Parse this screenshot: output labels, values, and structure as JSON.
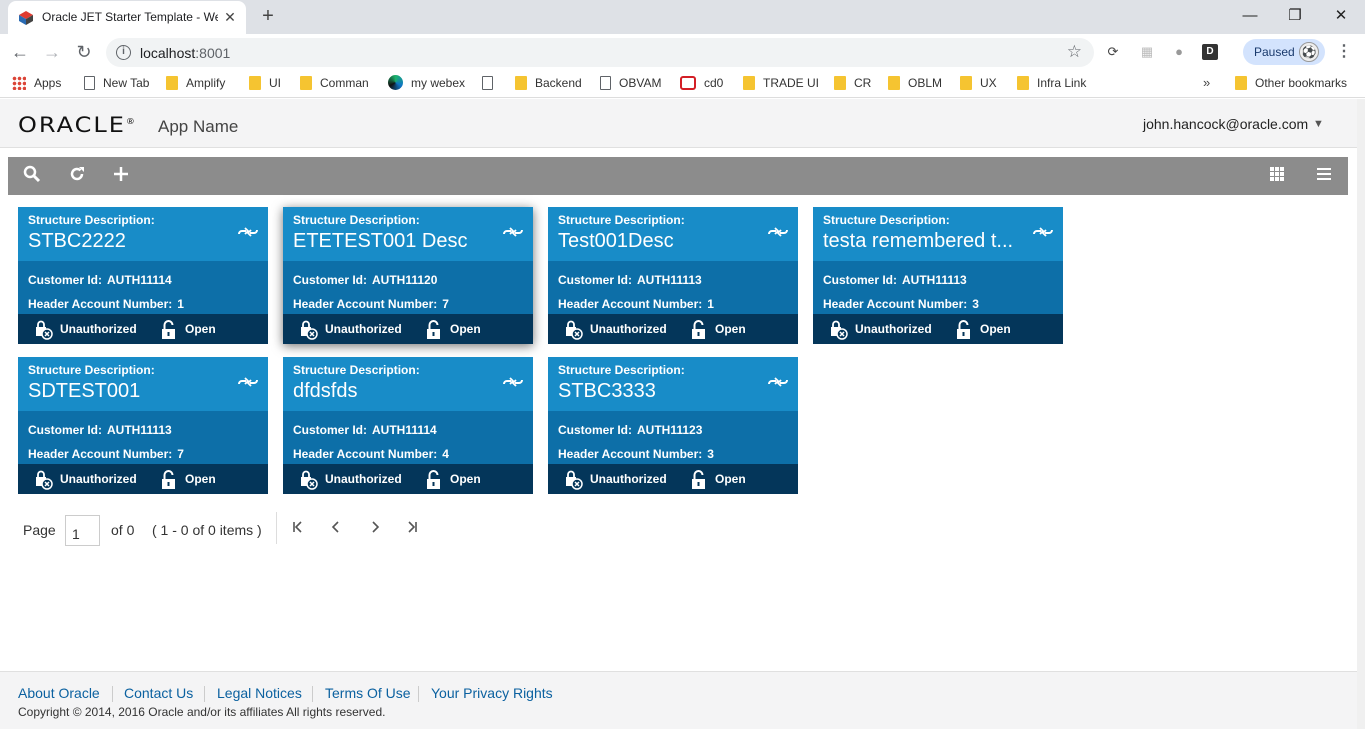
{
  "browser": {
    "tab_title": "Oracle JET Starter Template - Web",
    "tab_close": "✕",
    "new_tab": "+",
    "window_controls": {
      "minimize": "—",
      "restore": "❐",
      "close": "✕"
    },
    "nav": {
      "back": "←",
      "forward": "→",
      "reload": "↻"
    },
    "url_host": "localhost",
    "url_port": ":8001",
    "star": "☆",
    "profile_status": "Paused",
    "menu": "⋮",
    "extensions": [
      {
        "icon": "sync-icon",
        "glyph": "⟳"
      },
      {
        "icon": "extension-grid-icon",
        "glyph": "▦"
      },
      {
        "icon": "extension-circle-icon",
        "glyph": "●"
      },
      {
        "icon": "extension-d-icon",
        "glyph": "D"
      }
    ]
  },
  "bookmarks": {
    "items": [
      {
        "label": "Apps",
        "icon": "apps-icon"
      },
      {
        "label": "New Tab",
        "icon": "page-icon"
      },
      {
        "label": "Amplify",
        "icon": "folder-icon"
      },
      {
        "label": "UI",
        "icon": "folder-icon"
      },
      {
        "label": "Comman",
        "icon": "folder-icon"
      },
      {
        "label": "my webex",
        "icon": "webex-icon"
      },
      {
        "label": "",
        "icon": "page-icon"
      },
      {
        "label": "Backend",
        "icon": "folder-icon"
      },
      {
        "label": "OBVAM",
        "icon": "page-icon"
      },
      {
        "label": "cd0",
        "icon": "cd0-icon"
      },
      {
        "label": "TRADE UI",
        "icon": "folder-icon"
      },
      {
        "label": "CR",
        "icon": "folder-icon"
      },
      {
        "label": "OBLM",
        "icon": "folder-icon"
      },
      {
        "label": "UX",
        "icon": "folder-icon"
      },
      {
        "label": "Infra Link",
        "icon": "folder-icon"
      }
    ],
    "more": "»",
    "other": "Other bookmarks"
  },
  "header": {
    "logo": "ORACLE",
    "logo_mark": "®",
    "app_name": "App Name",
    "user": "john.hancock@oracle.com",
    "user_caret": "▼"
  },
  "toolbar": {
    "search": "search-icon",
    "refresh": "refresh-icon",
    "add": "add-icon",
    "grid_view": "grid-view-icon",
    "list_view": "list-view-icon"
  },
  "cards": [
    {
      "label": "Structure Description:",
      "title": "STBC2222",
      "customer_label": "Customer Id:",
      "customer_id": "AUTH11114",
      "account_label": "Header Account Number:",
      "account": "1",
      "status": "Unauthorized",
      "state": "Open"
    },
    {
      "label": "Structure Description:",
      "title": "ETETEST001 Desc",
      "customer_label": "Customer Id:",
      "customer_id": "AUTH11120",
      "account_label": "Header Account Number:",
      "account": "7",
      "status": "Unauthorized",
      "state": "Open"
    },
    {
      "label": "Structure Description:",
      "title": "Test001Desc",
      "customer_label": "Customer Id:",
      "customer_id": "AUTH11113",
      "account_label": "Header Account Number:",
      "account": "1",
      "status": "Unauthorized",
      "state": "Open"
    },
    {
      "label": "Structure Description:",
      "title": "testa remembered t...",
      "customer_label": "Customer Id:",
      "customer_id": "AUTH11113",
      "account_label": "Header Account Number:",
      "account": "3",
      "status": "Unauthorized",
      "state": "Open"
    },
    {
      "label": "Structure Description:",
      "title": "SDTEST001",
      "customer_label": "Customer Id:",
      "customer_id": "AUTH11113",
      "account_label": "Header Account Number:",
      "account": "7",
      "status": "Unauthorized",
      "state": "Open"
    },
    {
      "label": "Structure Description:",
      "title": "dfdsfds",
      "customer_label": "Customer Id:",
      "customer_id": "AUTH11114",
      "account_label": "Header Account Number:",
      "account": "4",
      "status": "Unauthorized",
      "state": "Open"
    },
    {
      "label": "Structure Description:",
      "title": "STBC3333",
      "customer_label": "Customer Id:",
      "customer_id": "AUTH11123",
      "account_label": "Header Account Number:",
      "account": "3",
      "status": "Unauthorized",
      "state": "Open"
    }
  ],
  "pager": {
    "page_label": "Page",
    "page_value": "1",
    "of_label": "of 0",
    "items_label": "( 1 - 0 of 0 items )",
    "first": "K",
    "prev": "‹",
    "next": "›",
    "last": "›|"
  },
  "footer": {
    "links": [
      "About Oracle",
      "Contact Us",
      "Legal Notices",
      "Terms Of Use",
      "Your Privacy Rights"
    ],
    "copyright": "Copyright © 2014, 2016 Oracle and/or its affiliates All rights reserved."
  },
  "colors": {
    "card_top": "#188cc8",
    "card_mid": "#0d6fa8",
    "card_foot": "#04365a",
    "toolbar_bg": "#8c8c8c",
    "link": "#0b61a0"
  }
}
